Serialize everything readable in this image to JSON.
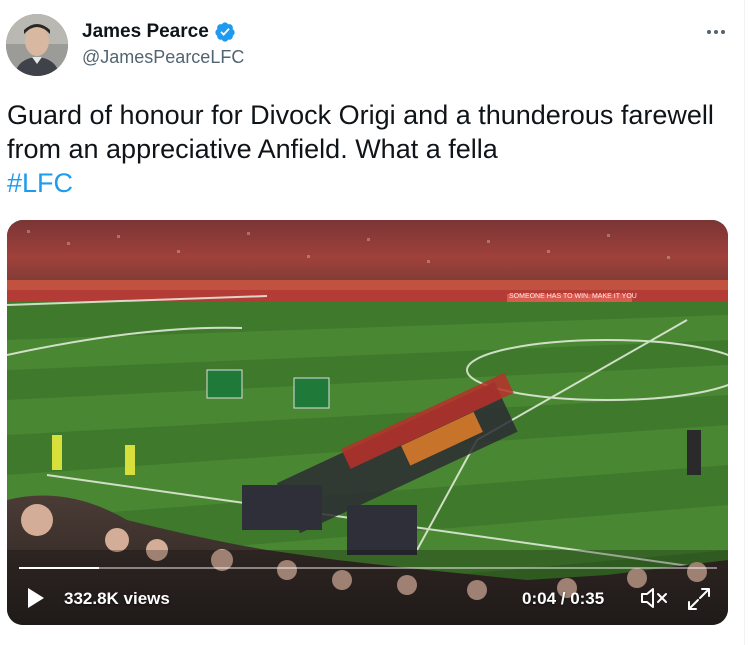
{
  "author": {
    "display_name": "James Pearce",
    "handle": "@JamesPearceLFC",
    "verified_icon": "verified-badge-icon",
    "avatar_icon": "avatar-photo"
  },
  "tweet": {
    "text": "Guard of honour for Divock Origi and a thunderous farewell from an appreciative Anfield. What a fella",
    "hashtag": "#LFC"
  },
  "video": {
    "views": "332.8K views",
    "time": "0:04 / 0:35",
    "progress_fraction": 0.114,
    "stadium_banner": "SOMEONE HAS TO WIN. MAKE IT YOU",
    "icons": [
      "play-icon",
      "volume-mute-icon",
      "expand-icon"
    ]
  },
  "colors": {
    "accent": "#1d9bf0",
    "text": "#0f1419",
    "secondary": "#536471"
  }
}
